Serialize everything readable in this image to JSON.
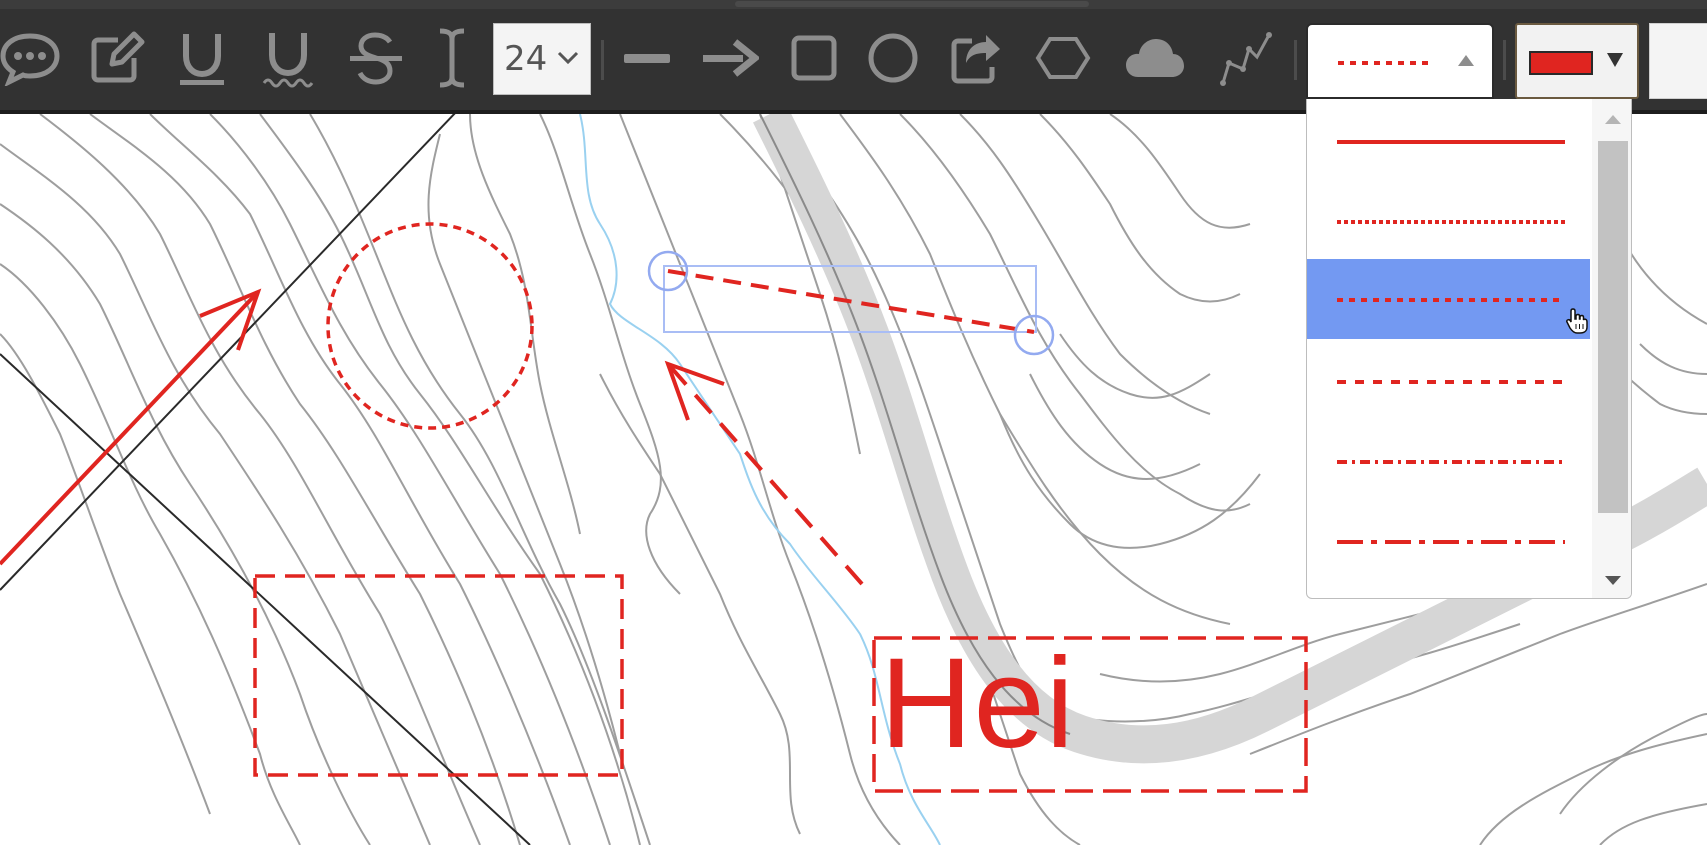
{
  "toolbar": {
    "tools": [
      {
        "name": "comment-tool",
        "icon": "speech-bubble-icon"
      },
      {
        "name": "pencil-tool",
        "icon": "pencil-edit-icon"
      },
      {
        "name": "underline-tool",
        "icon": "underline-icon",
        "glyph": "U"
      },
      {
        "name": "squiggly-underline-tool",
        "icon": "squiggly-underline-icon",
        "glyph": "U"
      },
      {
        "name": "strikethrough-tool",
        "icon": "strikethrough-icon",
        "glyph": "S"
      },
      {
        "name": "text-cursor-tool",
        "icon": "text-cursor-icon"
      },
      {
        "name": "line-tool",
        "icon": "line-icon"
      },
      {
        "name": "arrow-tool",
        "icon": "arrow-right-icon"
      },
      {
        "name": "rectangle-tool",
        "icon": "square-icon"
      },
      {
        "name": "circle-tool",
        "icon": "circle-icon"
      },
      {
        "name": "share-tool",
        "icon": "share-icon"
      },
      {
        "name": "polygon-tool",
        "icon": "hexagon-icon"
      },
      {
        "name": "cloud-tool",
        "icon": "cloud-icon"
      },
      {
        "name": "polyline-tool",
        "icon": "polyline-icon"
      }
    ],
    "font_size": "24",
    "line_style_selected": "dotted-medium",
    "stroke_color": "#e02520"
  },
  "line_style_dropdown": {
    "options": [
      "solid",
      "dotted-fine",
      "dotted-medium",
      "dashed",
      "dash-dot",
      "dash-dot-dot"
    ],
    "selected_index": 2
  },
  "canvas": {
    "annotation_text": "Hei",
    "annotation_color": "#e02520",
    "selection_color": "#a9bdf5"
  }
}
